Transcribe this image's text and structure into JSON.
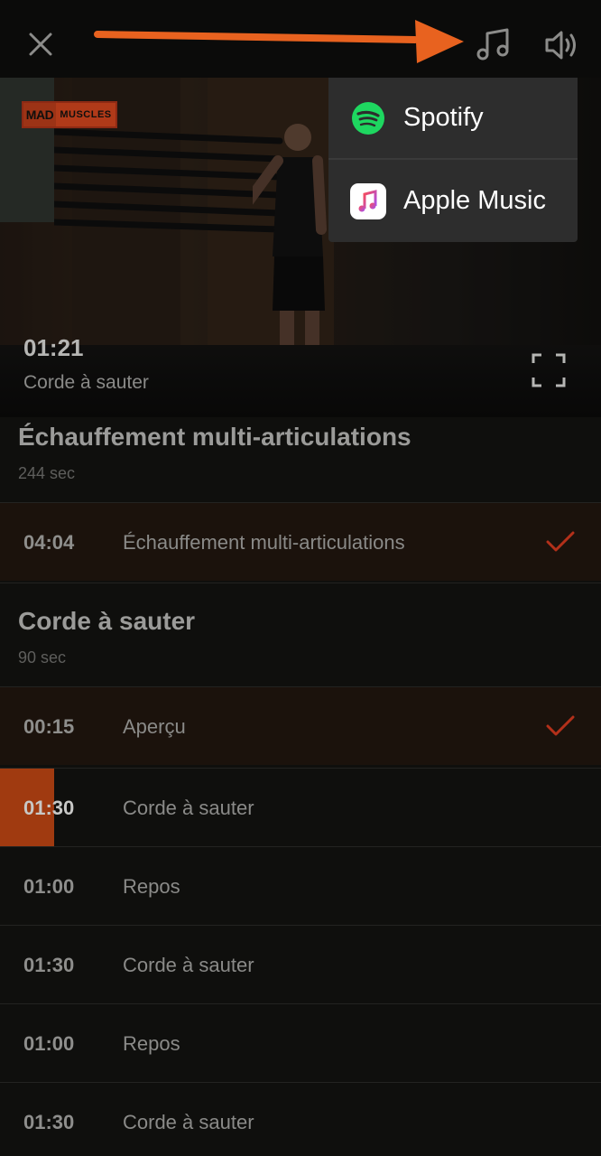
{
  "video": {
    "logo_part1": "MAD",
    "logo_part2": "MUSCLES",
    "time": "01:21",
    "exercise": "Corde à sauter"
  },
  "music_menu": {
    "items": [
      {
        "label": "Spotify",
        "icon": "spotify-icon"
      },
      {
        "label": "Apple Music",
        "icon": "apple-music-icon"
      }
    ]
  },
  "sections": [
    {
      "title": "Échauffement multi-articulations",
      "subtitle": "244 sec",
      "rows": [
        {
          "time": "04:04",
          "name": "Échauffement multi-articulations",
          "done": true
        }
      ]
    },
    {
      "title": "Corde à sauter",
      "subtitle": "90 sec",
      "rows": [
        {
          "time": "00:15",
          "name": "Aperçu",
          "done": true
        },
        {
          "time": "01:30",
          "name": "Corde à sauter",
          "current": true
        },
        {
          "time": "01:00",
          "name": "Repos"
        },
        {
          "time": "01:30",
          "name": "Corde à sauter"
        },
        {
          "time": "01:00",
          "name": "Repos"
        },
        {
          "time": "01:30",
          "name": "Corde à sauter"
        }
      ]
    }
  ],
  "colors": {
    "accent": "#e8621f",
    "check": "#b3301a",
    "progress": "#a03a10",
    "spotify": "#1ed760"
  }
}
